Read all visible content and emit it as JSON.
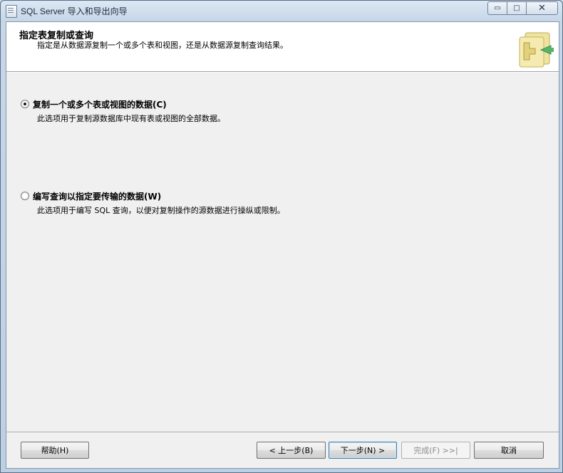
{
  "window": {
    "title": "SQL Server 导入和导出向导",
    "controls": {
      "minimize": "▭",
      "maximize": "□",
      "close": "✕"
    }
  },
  "header": {
    "title": "指定表复制或查询",
    "subtitle": "指定是从数据源复制一个或多个表和视图，还是从数据源复制查询结果。",
    "graphic_icon": "wizard-transfer-icon"
  },
  "options": [
    {
      "label": "复制一个或多个表或视图的数据(C)",
      "description": "此选项用于复制源数据库中现有表或视图的全部数据。",
      "selected": true
    },
    {
      "label": "编写查询以指定要传输的数据(W)",
      "description": "此选项用于编写 SQL 查询，以便对复制操作的源数据进行操纵或限制。",
      "selected": false
    }
  ],
  "buttons": {
    "help": "帮助(H)",
    "back": "< 上一步(B)",
    "next": "下一步(N) >",
    "finish": "完成(F) >>|",
    "cancel": "取消"
  }
}
